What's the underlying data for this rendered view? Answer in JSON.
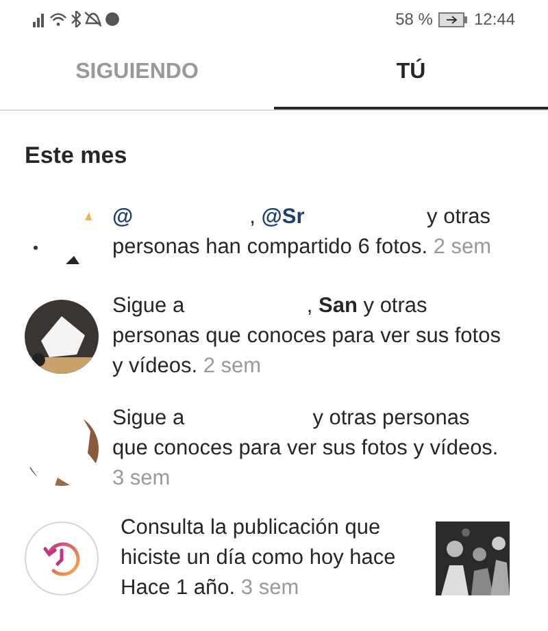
{
  "status_bar": {
    "battery": "58 %",
    "time": "12:44"
  },
  "tabs": [
    {
      "label": "SIGUIENDO",
      "selected": false
    },
    {
      "label": "TÚ",
      "selected": true
    }
  ],
  "section": "Este mes",
  "items": [
    {
      "kind": "group",
      "parts": [
        {
          "kind": "mention",
          "text": "@"
        },
        {
          "kind": "redacted"
        },
        {
          "kind": "plain",
          "text": ", "
        },
        {
          "kind": "mention",
          "text": "@Sr"
        },
        {
          "kind": "redacted"
        },
        {
          "kind": "plain",
          "text": " y otras personas han compartido 6 fotos."
        }
      ],
      "time": "2 sem"
    },
    {
      "kind": "dark",
      "parts": [
        {
          "kind": "plain",
          "text": "Sigue a "
        },
        {
          "kind": "redacted"
        },
        {
          "kind": "plain",
          "text": ", "
        },
        {
          "kind": "bold",
          "text": "San"
        },
        {
          "kind": "plain",
          "text": " y otras personas que conoces para ver sus fotos y vídeos."
        }
      ],
      "time": "2 sem"
    },
    {
      "kind": "light",
      "parts": [
        {
          "kind": "plain",
          "text": "Sigue a "
        },
        {
          "kind": "redacted"
        },
        {
          "kind": "plain",
          "text": " y otras personas que conoces para ver sus fotos y vídeos."
        }
      ],
      "time": "3 sem"
    },
    {
      "kind": "memory",
      "parts": [
        {
          "kind": "plain",
          "text": "Consulta la publicación que hiciste un día como hoy hace Hace 1 año."
        }
      ],
      "time": "3 sem"
    }
  ]
}
